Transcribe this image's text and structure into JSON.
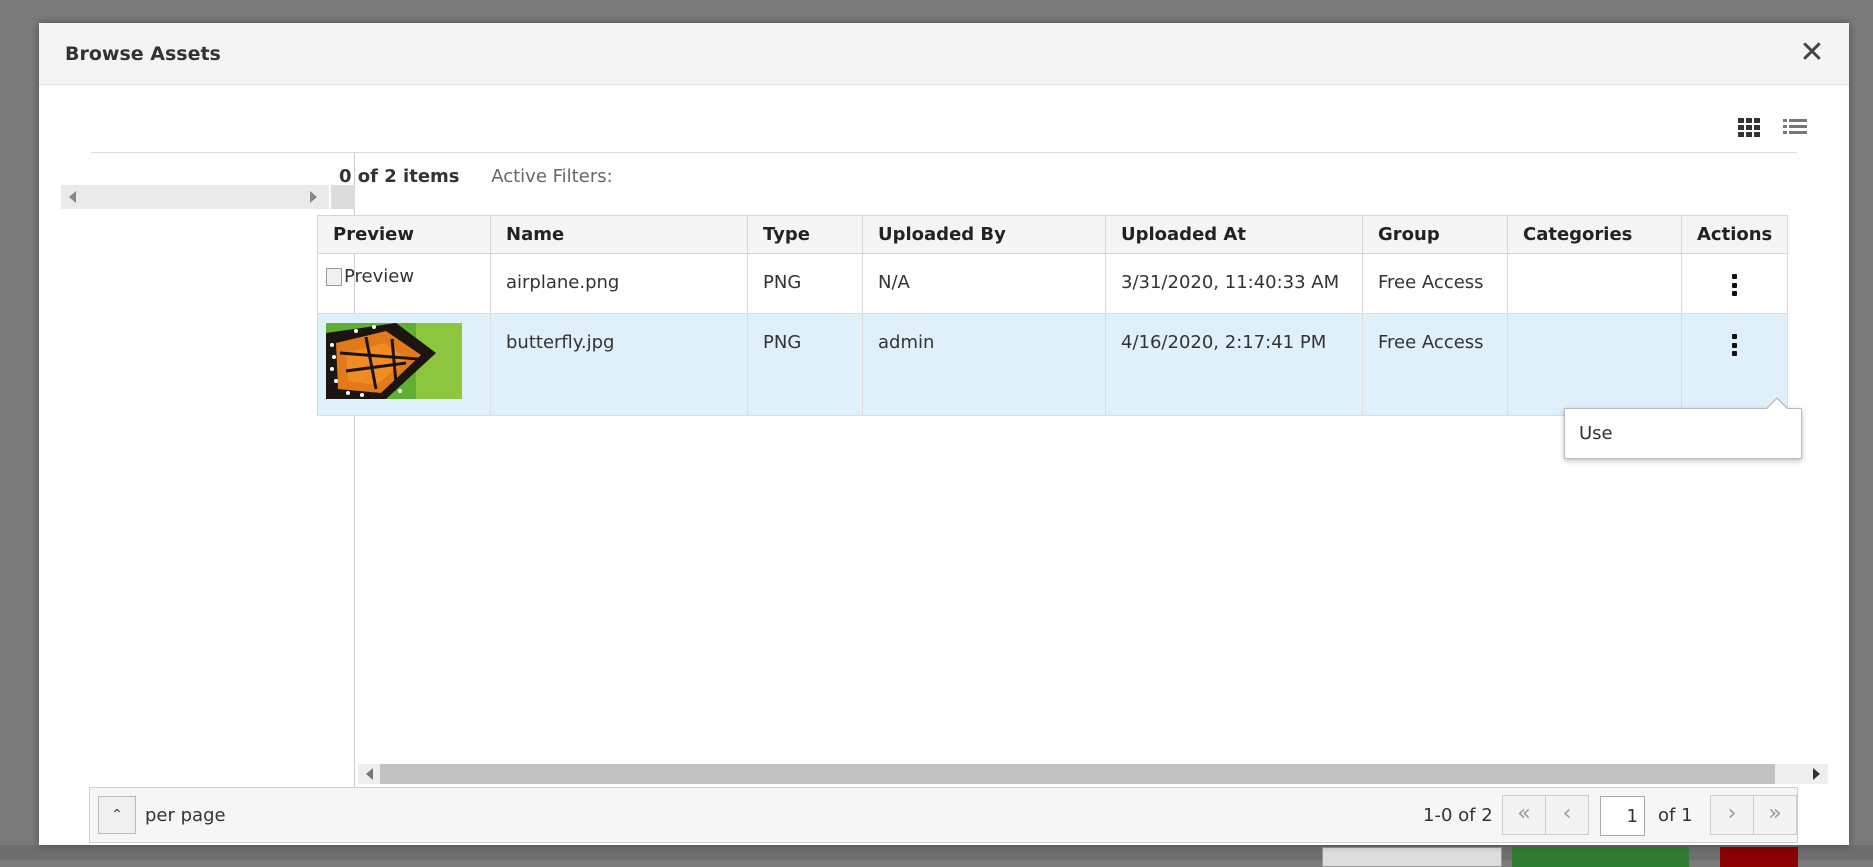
{
  "modal": {
    "title": "Browse Assets",
    "close_symbol": "✕"
  },
  "view_toggle": {
    "grid_icon": "grid-view-icon",
    "list_icon": "list-view-icon"
  },
  "toolbar": {
    "items_count": "0 of 2 items",
    "active_filters": "Active Filters:"
  },
  "table": {
    "columns": [
      "Preview",
      "Name",
      "Type",
      "Uploaded By",
      "Uploaded At",
      "Group",
      "Categories",
      "Actions"
    ],
    "rows": [
      {
        "preview_alt": "Preview",
        "name": "airplane.png",
        "type": "PNG",
        "uploaded_by": "N/A",
        "uploaded_at": "3/31/2020, 11:40:33 AM",
        "group": "Free Access",
        "categories": ""
      },
      {
        "preview_image": "butterfly-thumbnail",
        "name": "butterfly.jpg",
        "type": "PNG",
        "uploaded_by": "admin",
        "uploaded_at": "4/16/2020, 2:17:41 PM",
        "group": "Free Access",
        "categories": "",
        "selected": true
      }
    ]
  },
  "actions_menu": {
    "items": [
      "Use"
    ]
  },
  "pagination": {
    "per_page_label": "per page",
    "range_text": "1-0 of 2",
    "current_page": "1",
    "total_pages_text": "of 1",
    "first_symbol": "«",
    "prev_symbol": "‹",
    "next_symbol": "›",
    "last_symbol": "»",
    "toggle_symbol": "⌃"
  },
  "colors": {
    "selected_row": "#dff0fb",
    "header_bg": "#f4f4f4"
  }
}
